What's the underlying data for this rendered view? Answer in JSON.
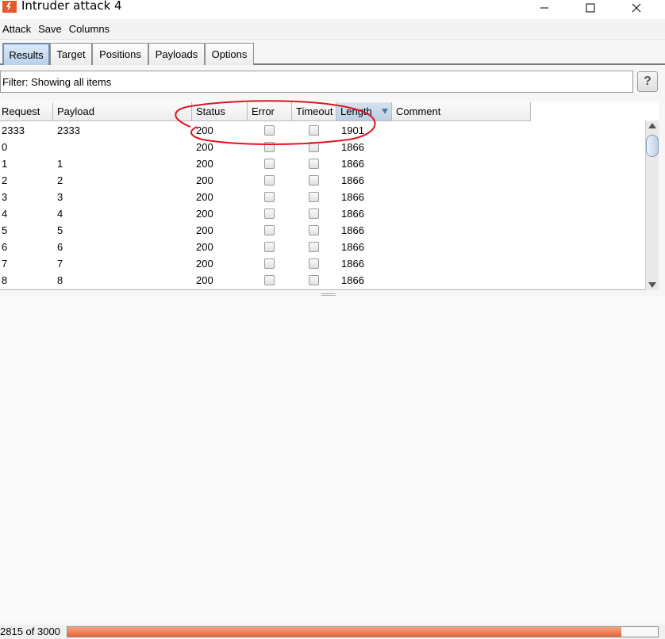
{
  "window": {
    "title": "Intruder attack 4",
    "icon": "burp-flame-icon",
    "controls": [
      "minimize",
      "maximize",
      "close"
    ]
  },
  "menu": [
    "Attack",
    "Save",
    "Columns"
  ],
  "tabs": [
    {
      "label": "Results",
      "active": true
    },
    {
      "label": "Target",
      "active": false
    },
    {
      "label": "Positions",
      "active": false
    },
    {
      "label": "Payloads",
      "active": false
    },
    {
      "label": "Options",
      "active": false
    }
  ],
  "filter": {
    "text": "Filter: Showing all items",
    "help_label": "?"
  },
  "table": {
    "columns": [
      "Request",
      "Payload",
      "Status",
      "Error",
      "Timeout",
      "Length",
      "Comment"
    ],
    "sorted_column": "Length",
    "rows": [
      {
        "request": "2333",
        "payload": "2333",
        "status": "200",
        "error": false,
        "timeout": false,
        "length": "1901",
        "comment": ""
      },
      {
        "request": "0",
        "payload": "",
        "status": "200",
        "error": false,
        "timeout": false,
        "length": "1866",
        "comment": ""
      },
      {
        "request": "1",
        "payload": "1",
        "status": "200",
        "error": false,
        "timeout": false,
        "length": "1866",
        "comment": ""
      },
      {
        "request": "2",
        "payload": "2",
        "status": "200",
        "error": false,
        "timeout": false,
        "length": "1866",
        "comment": ""
      },
      {
        "request": "3",
        "payload": "3",
        "status": "200",
        "error": false,
        "timeout": false,
        "length": "1866",
        "comment": ""
      },
      {
        "request": "4",
        "payload": "4",
        "status": "200",
        "error": false,
        "timeout": false,
        "length": "1866",
        "comment": ""
      },
      {
        "request": "5",
        "payload": "5",
        "status": "200",
        "error": false,
        "timeout": false,
        "length": "1866",
        "comment": ""
      },
      {
        "request": "6",
        "payload": "6",
        "status": "200",
        "error": false,
        "timeout": false,
        "length": "1866",
        "comment": ""
      },
      {
        "request": "7",
        "payload": "7",
        "status": "200",
        "error": false,
        "timeout": false,
        "length": "1866",
        "comment": ""
      },
      {
        "request": "8",
        "payload": "8",
        "status": "200",
        "error": false,
        "timeout": false,
        "length": "1866",
        "comment": ""
      }
    ]
  },
  "progress": {
    "text": "2815 of 3000",
    "done": 2815,
    "total": 3000
  },
  "colors": {
    "accent": "#e8643a",
    "annotation": "#e0141e",
    "tab_active": "#b8d1ea"
  }
}
